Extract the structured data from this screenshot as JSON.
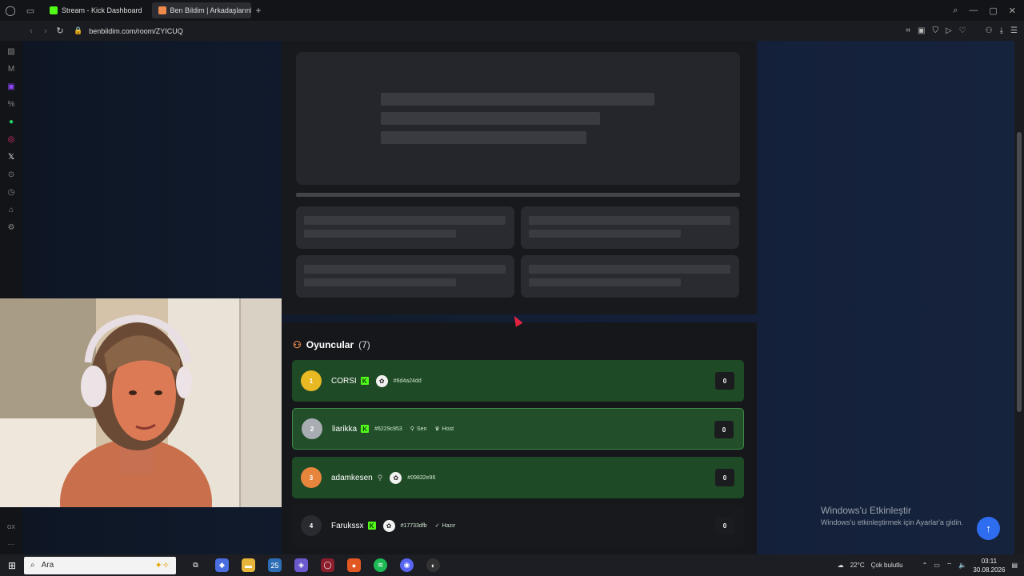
{
  "browser": {
    "tabs": [
      {
        "label": "Stream - Kick Dashboard",
        "favicon_color": "#53fc18",
        "active": false
      },
      {
        "label": "Ben Bildim | Arkadaşlarınla",
        "favicon_color": "#f08a4b",
        "active": true
      }
    ],
    "url": "benbildim.com/room/ZYICUQ"
  },
  "players": {
    "title": "Oyuncular",
    "count": "(7)",
    "rows": [
      {
        "rank": "1",
        "name": "CORSI",
        "hash": "#6d4a24dd",
        "score": "0",
        "rank_color": "#e8b923"
      },
      {
        "rank": "2",
        "name": "liarikka",
        "hash": "#6229c953",
        "you_label": "Sen",
        "host_label": "Host",
        "score": "0",
        "rank_color": "#a9adb3"
      },
      {
        "rank": "3",
        "name": "adamkesen",
        "hash": "#09832e96",
        "score": "0",
        "rank_color": "#e8853d"
      },
      {
        "rank": "4",
        "name": "Farukssx",
        "hash": "#17733dfb",
        "ready_label": "Hazır",
        "score": "0",
        "rank_color": "#2a2b30"
      }
    ]
  },
  "watermark": {
    "title": "Windows'u Etkinleştir",
    "subtitle": "Windows'u etkinleştirmek için Ayarlar'a gidin."
  },
  "taskbar": {
    "search_placeholder": "Ara",
    "weather": "22°C",
    "weather_text": "Çok bulutlu",
    "time": "03:11",
    "date": "30.08.2026"
  },
  "colors": {
    "accent": "#53fc18",
    "row_green": "#1f4a26",
    "scroll_top": "#2f6df0"
  }
}
